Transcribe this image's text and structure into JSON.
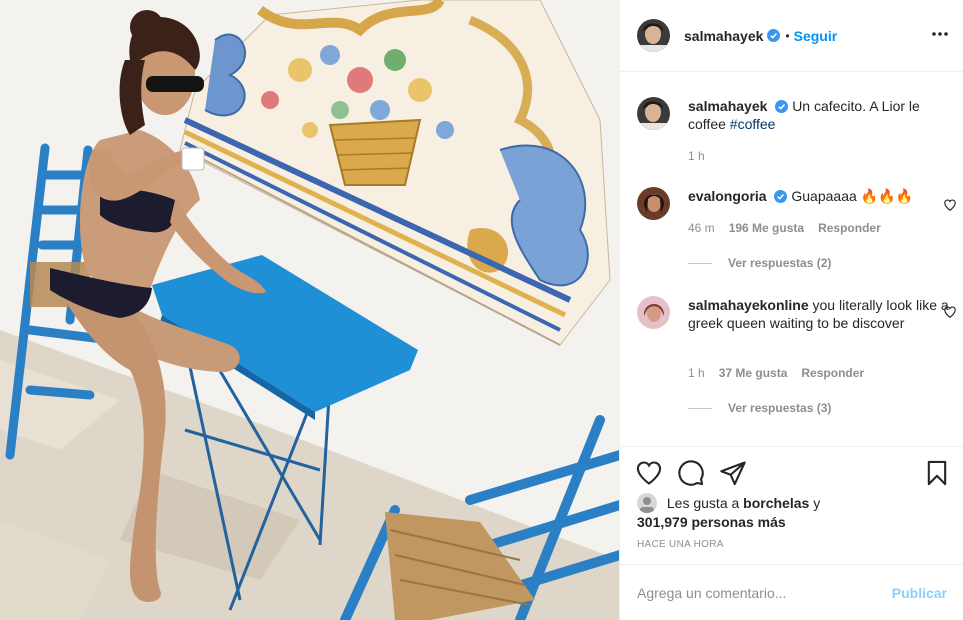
{
  "post": {
    "author": "salmahayek",
    "follow_label": "Seguir",
    "separator": "•",
    "caption_text": "Un cafecito. A Lior le coffee",
    "caption_hashtag": "#coffee",
    "caption_time": "1 h"
  },
  "comments": [
    {
      "user": "evalongoria",
      "text": "Guapaaaa 🔥🔥🔥",
      "time": "46 m",
      "likes": "196 Me gusta",
      "reply_label": "Responder",
      "view_replies": "Ver respuestas (2)"
    },
    {
      "user": "salmahayekonline",
      "text": "you literally look like a greek queen waiting to be discover",
      "time": "1 h",
      "likes": "37 Me gusta",
      "reply_label": "Responder",
      "view_replies": "Ver respuestas (3)"
    }
  ],
  "likes_summary": {
    "prefix": "Les gusta a",
    "user": "borchelas",
    "conj": "y",
    "others": "301,979 personas más"
  },
  "timestamp": "HACE UNA HORA",
  "comment_box": {
    "placeholder": "Agrega un comentario...",
    "publish_label": "Publicar"
  },
  "colors": {
    "accent": "#0095f6",
    "verified": "#3897f0",
    "chair_blue": "#2b7fc4",
    "table_blue": "#1f8fd6"
  },
  "icons": [
    "more-options-icon",
    "heart-icon",
    "comment-icon",
    "share-icon",
    "bookmark-icon",
    "verified-icon"
  ]
}
